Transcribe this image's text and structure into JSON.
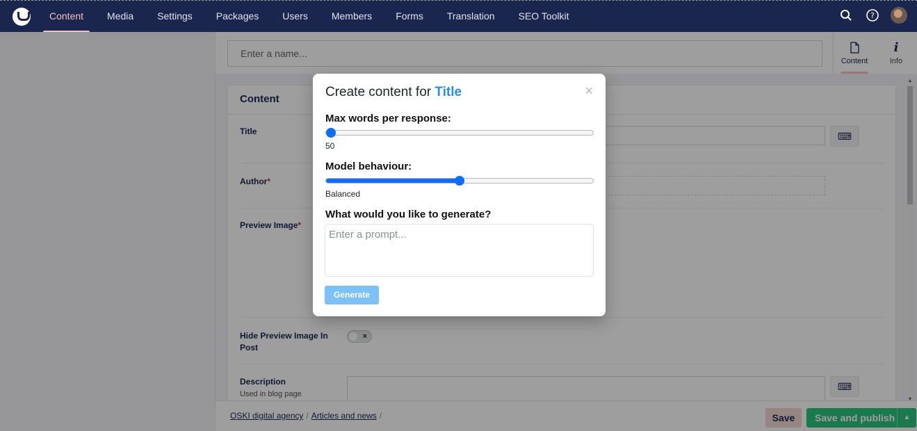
{
  "nav": {
    "items": [
      "Content",
      "Media",
      "Settings",
      "Packages",
      "Users",
      "Members",
      "Forms",
      "Translation",
      "SEO Toolkit"
    ],
    "active_index": 0
  },
  "topbar": {
    "icons": [
      "search-icon",
      "help-icon",
      "user-avatar"
    ]
  },
  "editor": {
    "name_placeholder": "Enter a name...",
    "app_tabs": [
      {
        "label": "Content",
        "icon": "document-icon",
        "active": true
      },
      {
        "label": "Info",
        "icon": "info-icon",
        "active": false
      }
    ],
    "panel_title": "Content",
    "properties": {
      "title": "Title",
      "author": "Author",
      "preview_image": "Preview Image",
      "hide_preview_line1": "Hide Preview Image In",
      "hide_preview_line2": "Post",
      "description": "Description",
      "description_help": "Used in blog page",
      "required_mark": "*"
    }
  },
  "footer": {
    "breadcrumbs": [
      "OSKI digital agency",
      "Articles and news"
    ],
    "separator": "/",
    "save_label": "Save",
    "publish_label": "Save and publish"
  },
  "modal": {
    "title_prefix": "Create content for",
    "title_field": "Title",
    "close_glyph": "×",
    "max_words_label": "Max words per response:",
    "max_words_value": "50",
    "max_words_fraction": 0.0,
    "behaviour_label": "Model behaviour:",
    "behaviour_value": "Balanced",
    "behaviour_fraction": 0.5,
    "prompt_label": "What would you like to generate?",
    "prompt_placeholder": "Enter a prompt...",
    "generate_label": "Generate"
  },
  "colors": {
    "nav_bg": "#1b264f",
    "nav_active": "#f5c1bc",
    "accent_blue": "#0d6efd",
    "title_highlight": "#2b8ee6",
    "publish_green": "#2bc37c"
  }
}
